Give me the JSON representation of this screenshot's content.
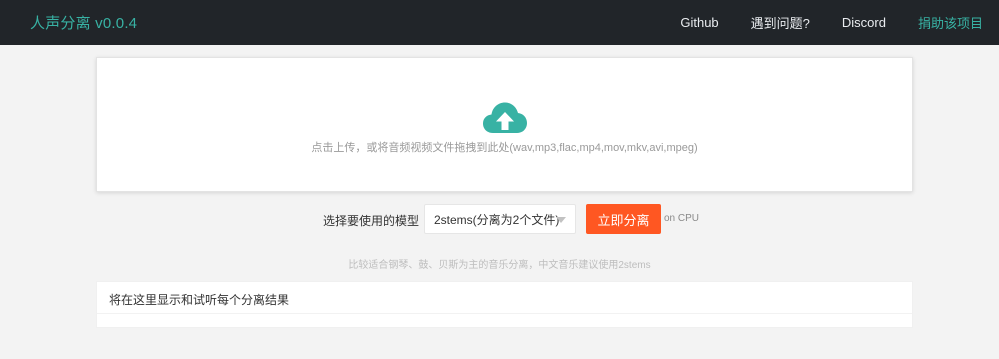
{
  "navbar": {
    "brand": "人声分离 v0.0.4",
    "links": [
      {
        "label": "Github",
        "accent": false
      },
      {
        "label": "遇到问题?",
        "accent": false
      },
      {
        "label": "Discord",
        "accent": false
      },
      {
        "label": "捐助该项目",
        "accent": true
      }
    ]
  },
  "upload": {
    "icon": "cloud-upload-icon",
    "hint": "点击上传，或将音频视频文件拖拽到此处(wav,mp3,flac,mp4,mov,mkv,avi,mpeg)"
  },
  "controls": {
    "model_label": "选择要使用的模型",
    "model_selected": "2stems(分离为2个文件)",
    "separate_button": "立即分离",
    "device": "on CPU",
    "tip": "比较适合钢琴、鼓、贝斯为主的音乐分离，中文音乐建议使用2stems"
  },
  "results": {
    "placeholder": "将在这里显示和试听每个分离结果"
  },
  "colors": {
    "navbar_bg": "#212529",
    "accent_teal": "#38b2a4",
    "button_orange": "#ff5722",
    "page_bg": "#f3f3f3"
  }
}
